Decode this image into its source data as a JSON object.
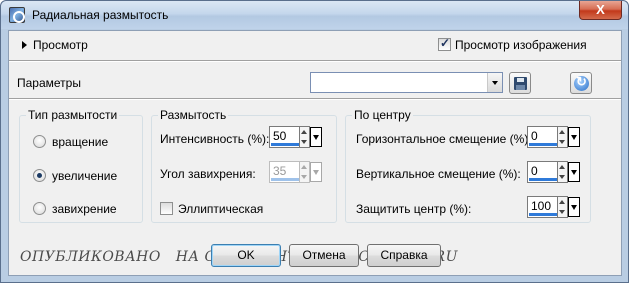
{
  "window": {
    "title": "Радиальная размытость",
    "close_label": "X"
  },
  "preview": {
    "label": "Просмотр",
    "checkbox_label": "Просмотр изображения",
    "checkbox_checked": true
  },
  "params": {
    "label": "Параметры",
    "combo_value": ""
  },
  "blur_type": {
    "title": "Тип размытости",
    "options": [
      {
        "label": "вращение",
        "selected": false
      },
      {
        "label": "увеличение",
        "selected": true
      },
      {
        "label": "завихрение",
        "selected": false
      }
    ]
  },
  "blur": {
    "title": "Размытость",
    "intensity_label": "Интенсивность (%):",
    "intensity_value": "50",
    "swirl_label": "Угол завихрения:",
    "swirl_value": "35",
    "swirl_disabled": true,
    "elliptical_label": "Эллиптическая",
    "elliptical_checked": false
  },
  "center": {
    "title": "По центру",
    "h_label": "Горизонтальное смещение (%):",
    "h_value": "0",
    "v_label": "Вертикальное смещение (%):",
    "v_value": "0",
    "protect_label": "Защитить центр (%):",
    "protect_value": "100"
  },
  "watermark": "ОПУБЛИКОВАНО   НА САЙТЕ   HTTP://PS-CS.UCOZ.RU",
  "buttons": {
    "ok": "OK",
    "cancel": "Отмена",
    "help": "Справка"
  }
}
